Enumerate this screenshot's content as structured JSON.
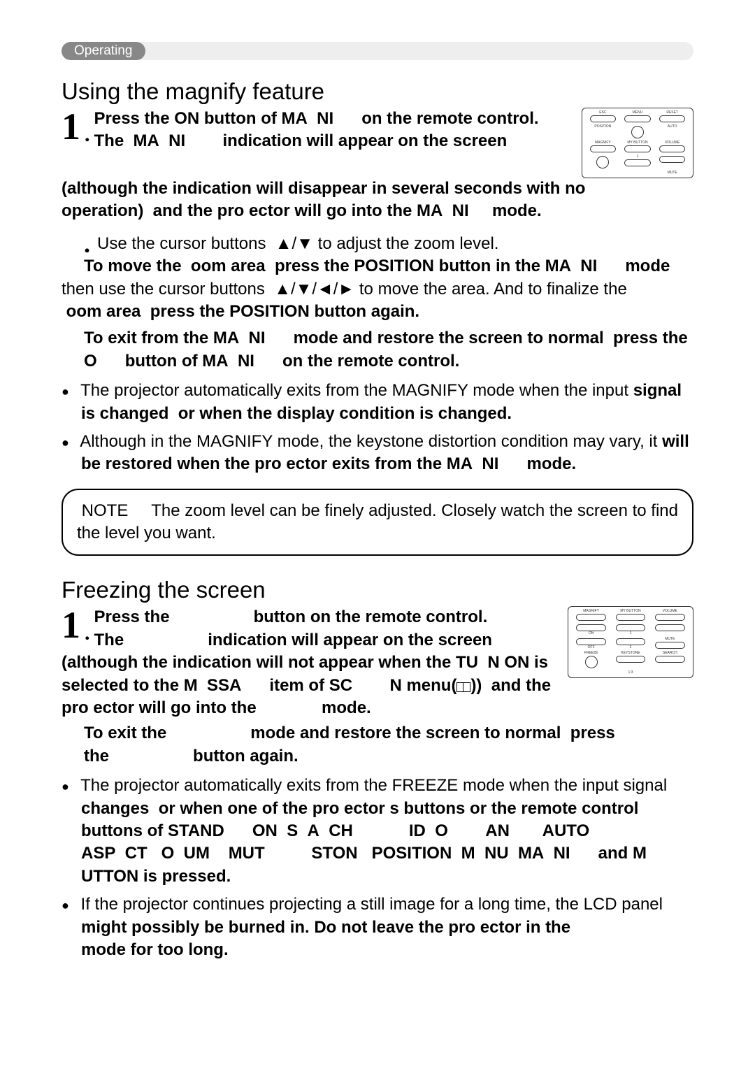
{
  "tag": "Operating",
  "magnify": {
    "title": "Using the magnify feature",
    "step1_a": "Press the ON button of MA  NI",
    "step1_b": "on the remote control.",
    "step1_c": "The  MA  NI",
    "step1_d": "indication will appear on the screen",
    "step1_e": "(although the indication will disappear in several seconds with no operation)  and the pro ector will go into the MA  NI",
    "step1_f": "mode.",
    "step2_a": "Use the cursor buttons  ",
    "step2_arrows1": "▲/▼",
    "step2_b": " to adjust the zoom level.",
    "step2_c": "To move the  oom area  press the POSITION button in the MA  NI",
    "step2_d": "mode",
    "step2_e": "then use the cursor buttons  ",
    "step2_arrows2": "▲/▼/◄/►",
    "step2_f": " to move the area. And to finalize the",
    "step2_g": "oom area  press the POSITION button again.",
    "step2_h": "To exit from the MA  NI",
    "step2_i": "mode and restore the screen to normal  press the O",
    "step2_j": "button of MA  NI",
    "step2_k": "on the remote control.",
    "bullet1_a": "The projector automatically exits from the MAGNIFY mode when the input ",
    "bullet1_b": "signal is changed  or when the display condition is changed.",
    "bullet2_a": "Although in the MAGNIFY mode, the keystone distortion condition may vary, it ",
    "bullet2_b": "will be restored when the pro ector exits from the MA  NI",
    "bullet2_c": "mode.",
    "note_label": "NOTE",
    "note_text": "The zoom level can be finely adjusted. Closely watch the screen to find the level you want.",
    "remote": {
      "r1": [
        "ESC",
        "MENU",
        "RESET"
      ],
      "r2": [
        "POSITION",
        "",
        "AUTO"
      ],
      "r3": [
        "MAGNIFY",
        "MY BUTTON",
        "VOLUME"
      ],
      "r4": [
        "",
        "1",
        ""
      ],
      "r5": [
        "",
        "",
        "MUTE"
      ]
    }
  },
  "freeze": {
    "title": "Freezing the screen",
    "step1_a": "Press the",
    "step1_b": "button on the remote control.",
    "step1_c": "The",
    "step1_d": "indication will appear on the screen (although the indication will not appear when the TU  N ON is selected to the M  SSA",
    "step1_e": "item of SC",
    "step1_f": "N menu(",
    "step1_g": "))  and the pro ector will go into the",
    "step1_h": "mode.",
    "step1_i": "To exit the",
    "step1_j": "mode and restore the screen to normal  press the",
    "step1_k": "button again.",
    "bullet1_a": "The projector automatically exits from the FREEZE mode when the input signal ",
    "bullet1_b": "changes  or when one of the pro ector s buttons or the remote control buttons of STAND",
    "bullet1_c": "ON  S  A  CH",
    "bullet1_d": "ID  O",
    "bullet1_e": "AN",
    "bullet1_f": "AUTO  ASP  CT   O  UM",
    "bullet1_g": "MUT",
    "bullet1_h": "STON   POSITION  M  NU  MA  NI",
    "bullet1_i": "and M",
    "bullet1_j": "UTTON is pressed.",
    "bullet2_a": "If the projector continues projecting a still image for a long time, the LCD panel ",
    "bullet2_b": "might possibly be burned in. Do not leave the pro ector in the",
    "bullet2_c": "mode for too long.",
    "remote": {
      "r1": [
        "MAGNIFY",
        "MY BUTTON",
        "VOLUME"
      ],
      "r2": [
        "ON",
        "1",
        ""
      ],
      "r3": [
        "OFF",
        "2",
        "MUTE"
      ],
      "r4": [
        "FREEZE",
        "KEYSTONE",
        "SEARCH"
      ],
      "r5": [
        "",
        "1:3",
        ""
      ]
    }
  }
}
